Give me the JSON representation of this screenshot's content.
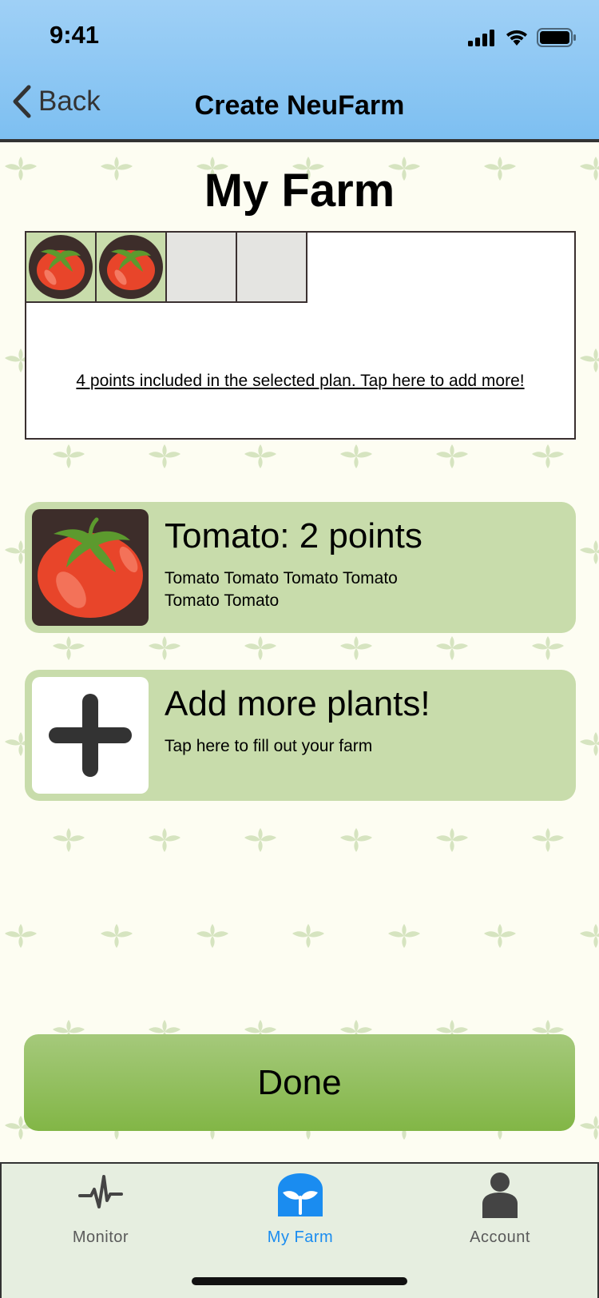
{
  "status_bar": {
    "time": "9:41"
  },
  "nav": {
    "back_label": "Back",
    "title": "Create NeuFarm"
  },
  "page": {
    "title": "My Farm"
  },
  "farm": {
    "plots": [
      "tomato",
      "tomato",
      "empty",
      "empty"
    ],
    "points_link": "4 points included in the selected plan. Tap here to add more!"
  },
  "plants": [
    {
      "heading": "Tomato: 2 points",
      "description": "Tomato Tomato Tomato Tomato Tomato Tomato",
      "icon": "tomato-icon"
    }
  ],
  "add_card": {
    "heading": "Add more plants!",
    "description": "Tap here to fill out your farm",
    "icon": "plus-icon"
  },
  "done_button": "Done",
  "tabs": [
    {
      "label": "Monitor",
      "icon": "pulse-icon",
      "active": false
    },
    {
      "label": "My Farm",
      "icon": "sprout-icon",
      "active": true
    },
    {
      "label": "Account",
      "icon": "person-icon",
      "active": false
    }
  ],
  "colors": {
    "header": "#7dbff1",
    "card": "#c8dcab",
    "done_button": "#82b646",
    "tab_active": "#1a8cf0",
    "tab_inactive": "#5a5a5a"
  }
}
